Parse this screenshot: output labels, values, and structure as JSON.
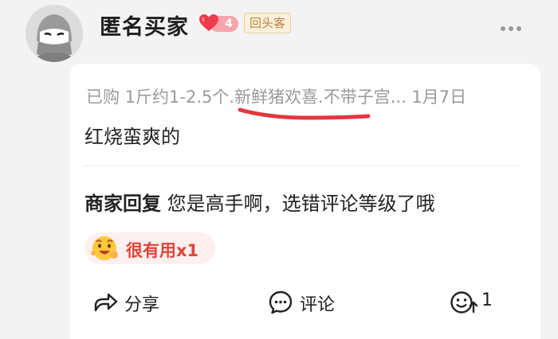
{
  "user": {
    "name": "匿名买家",
    "level": "4",
    "repeat_tag": "回头客"
  },
  "review": {
    "meta": "已购 1斤约1-2.5个.新鲜猪欢喜.不带子宫... 1月7日",
    "text": "红烧蛮爽的"
  },
  "seller_reply": {
    "label": "商家回复",
    "text": " 您是高手啊，选错评论等级了哦"
  },
  "useful": {
    "label": "很有用x1"
  },
  "actions": {
    "share": "分享",
    "comment": "评论",
    "like_count": "1"
  },
  "colors": {
    "accent_red": "#e0453a",
    "underline_red": "#e3373f",
    "tag_gold": "#b98644"
  },
  "icons": [
    "avatar-ninja-icon",
    "heart-icon",
    "more-icon",
    "emoji-icon",
    "share-icon",
    "comment-icon",
    "like-icon"
  ]
}
